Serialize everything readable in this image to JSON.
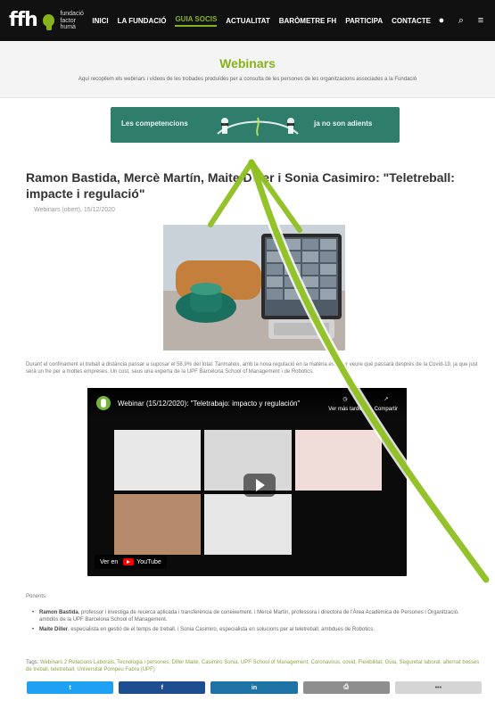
{
  "brand": {
    "logo_text": "ffh",
    "logo_subline_1": "fundació",
    "logo_subline_2": "factor humà"
  },
  "nav": {
    "items": [
      {
        "label": "INICI",
        "active": false
      },
      {
        "label": "LA FUNDACIÓ",
        "active": false
      },
      {
        "label": "GUIA SOCIS",
        "active": true
      },
      {
        "label": "ACTUALITAT",
        "active": false
      },
      {
        "label": "BARÒMETRE FH",
        "active": false
      },
      {
        "label": "PARTICIPA",
        "active": false
      },
      {
        "label": "CONTACTE",
        "active": false
      }
    ],
    "icons": [
      {
        "name": "user-icon",
        "glyph": "●"
      },
      {
        "name": "search-icon",
        "glyph": "⌕"
      },
      {
        "name": "menu-icon",
        "glyph": "≡"
      }
    ]
  },
  "hero": {
    "title": "Webinars",
    "subtitle": "Aquí recopilem els webinars i vídeos de les trobades produïdes per a consulta de les persones de les organitzacions associades a la Fundació"
  },
  "banner": {
    "left_text": "Les competencions",
    "right_text": "ja no son adients"
  },
  "article": {
    "title": "Ramon Bastida, Mercè Martín, Maite Diller i Sonia Casimiro: \"Teletreball: impacte i regulació\"",
    "meta": "Webinars (obert), 15/12/2020",
    "paragraph": "Durant el confinament el treball a distància passar a suposar el 58,9% del total. Tanmateix, amb la nova regulació en la matèria està per veure què passarà després de la Covid-19, ja que just serà un fre per a moltes empreses. Un cost, seus una experta de la UPF Barcelona School of Management i de Robotics."
  },
  "video": {
    "title": "Webinar (15/12/2020): \"Teletrabajo: impacto y regulación\"",
    "action_later": "Ver más tarde",
    "action_share": "Compartir",
    "watch_on": "Ver en",
    "youtube": "YouTube"
  },
  "speakers": {
    "label": "Ponents:",
    "items": [
      {
        "name": "Ramon Bastida",
        "text": ", professor i investiga de recerca aplicada i transferència de coneixement. i Mercè Martín, professora i directora de l'Àrea Acadèmica de Persones i Organització. ambdós de la UPF Barcelona School of Management."
      },
      {
        "name": "Maite Diller",
        "text": ", especialista en gestió de el temps de treball. i Sonia Casimiro, especialista en solucions per al teletreball. ambdues de Robotics."
      }
    ]
  },
  "tags": {
    "label": "Tags:",
    "text": "Webinars 2 Relacions Laborals, Tecnologia i persones, Diller Maite, Casimiro Sonia, UPF School of Management, Coronavirus, covid, Flexibilitat, Guia, Seguretat laboral, alternat bosses de treball, teletreball, Universitat Pompeu Fabra (UPF)"
  },
  "share": {
    "twitter": "t",
    "facebook": "f",
    "linkedin": "in",
    "print": "⎙",
    "more": "•••"
  }
}
